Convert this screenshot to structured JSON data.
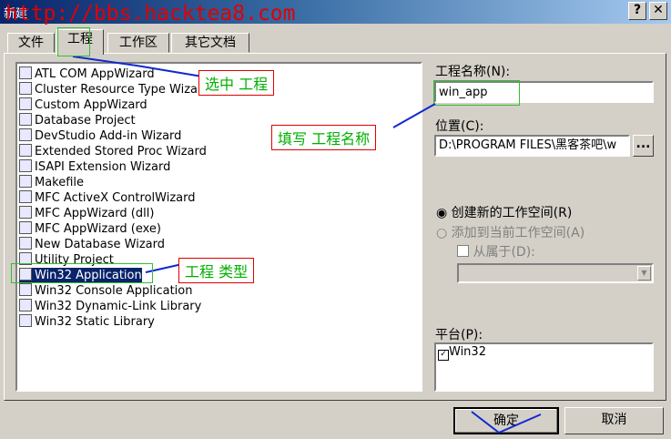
{
  "window": {
    "title": "新建",
    "watermark": "http://bbs.hacktea8.com",
    "help_label": "?",
    "close_label": "✕"
  },
  "tabs": [
    {
      "label": "文件"
    },
    {
      "label": "工程"
    },
    {
      "label": "工作区"
    },
    {
      "label": "其它文档"
    }
  ],
  "project_types": [
    {
      "label": "ATL COM AppWizard",
      "icon": "atl-icon"
    },
    {
      "label": "Cluster Resource Type Wizard",
      "icon": "cluster-icon"
    },
    {
      "label": "Custom AppWizard",
      "icon": "custom-icon"
    },
    {
      "label": "Database Project",
      "icon": "database-icon"
    },
    {
      "label": "DevStudio Add-in Wizard",
      "icon": "addin-icon"
    },
    {
      "label": "Extended Stored Proc Wizard",
      "icon": "storedproc-icon"
    },
    {
      "label": "ISAPI Extension Wizard",
      "icon": "globe-icon"
    },
    {
      "label": "Makefile",
      "icon": "makefile-icon"
    },
    {
      "label": "MFC ActiveX ControlWizard",
      "icon": "activex-icon"
    },
    {
      "label": "MFC AppWizard (dll)",
      "icon": "mfc-dll-icon"
    },
    {
      "label": "MFC AppWizard (exe)",
      "icon": "mfc-exe-icon"
    },
    {
      "label": "New Database Wizard",
      "icon": "newdb-icon"
    },
    {
      "label": "Utility Project",
      "icon": "utility-icon"
    },
    {
      "label": "Win32 Application",
      "icon": "win32-app-icon",
      "selected": true
    },
    {
      "label": "Win32 Console Application",
      "icon": "console-icon"
    },
    {
      "label": "Win32 Dynamic-Link Library",
      "icon": "dll-icon"
    },
    {
      "label": "Win32 Static Library",
      "icon": "lib-icon"
    }
  ],
  "project_name": {
    "label": "工程名称(N):",
    "value": "win_app"
  },
  "location": {
    "label": "位置(C):",
    "value": "D:\\PROGRAM FILES\\黑客茶吧\\w",
    "browse_label": "..."
  },
  "workspace": {
    "create_new": "创建新的工作空间(R)",
    "add_current": "添加到当前工作空间(A)",
    "dependency": "从属于(D):"
  },
  "platform": {
    "label": "平台(P):",
    "items": [
      "Win32"
    ]
  },
  "annotations": {
    "select_project": "选中 工程",
    "fill_name": "填写 工程名称",
    "project_type": "工程 类型"
  },
  "buttons": {
    "ok": "确定",
    "cancel": "取消"
  },
  "colors": {
    "selection": "#0a246a",
    "annotation_red": "#e00000",
    "annotation_green": "#00b000",
    "pointer_blue": "#1028d0"
  }
}
